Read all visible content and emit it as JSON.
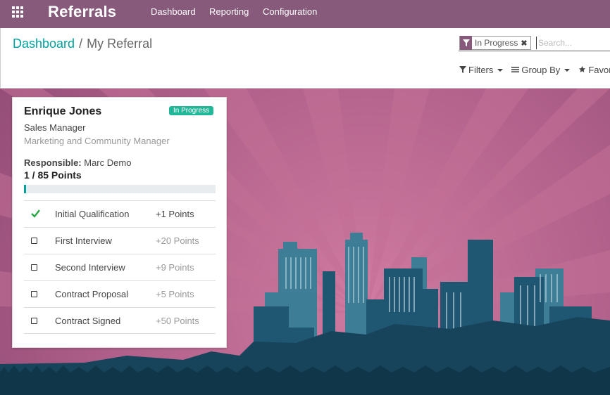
{
  "navbar": {
    "brand": "Referrals",
    "menu": [
      "Dashboard",
      "Reporting",
      "Configuration"
    ],
    "color": "#875A7B"
  },
  "breadcrumb": {
    "parent": "Dashboard",
    "separator": "/",
    "current": "My Referral"
  },
  "search": {
    "facet_value": "In Progress",
    "facet_remove": "✖",
    "placeholder": "Search...",
    "options": [
      "Filters",
      "Group By",
      "Favorites"
    ]
  },
  "card": {
    "name": "Enrique Jones",
    "status": "In Progress",
    "job_title": "Sales Manager",
    "department": "Marketing and Community Manager",
    "responsible_label": "Responsible:",
    "responsible_value": "Marc Demo",
    "points_text": "1 / 85 Points",
    "progress": 0.0118,
    "stages": [
      {
        "label": "Initial Qualification",
        "points": "+1 Points",
        "done": true
      },
      {
        "label": "First Interview",
        "points": "+20 Points",
        "done": false
      },
      {
        "label": "Second Interview",
        "points": "+9 Points",
        "done": false
      },
      {
        "label": "Contract Proposal",
        "points": "+5 Points",
        "done": false
      },
      {
        "label": "Contract Signed",
        "points": "+50 Points",
        "done": false
      }
    ]
  },
  "colors": {
    "accent": "#00A09D",
    "badge": "#21b799",
    "check": "#28a745"
  }
}
